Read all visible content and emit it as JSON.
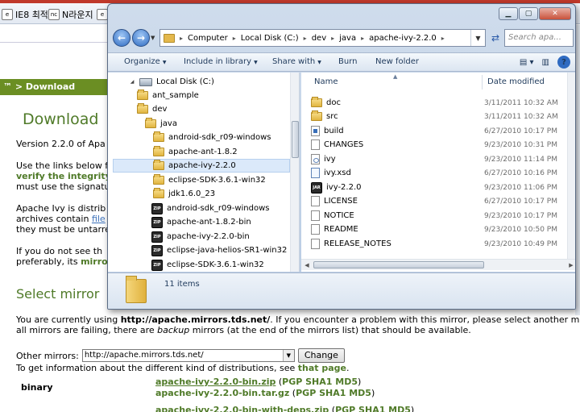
{
  "browser": {
    "favorites": [
      "IE8 최적화",
      "N라운지"
    ],
    "breadcrumb": "™ > Download",
    "page_title": "Download",
    "para1": "Version 2.2.0 of Apa",
    "para2": [
      "Use the links below f",
      "verify the integrity",
      "must use the signatu"
    ],
    "para3": [
      "Apache Ivy is distrib",
      "archives contain",
      "file",
      "they must be untarre"
    ],
    "para4": [
      "If you do not see th",
      "preferably, its",
      "mirror"
    ],
    "select_mirror_heading": "Select mirror",
    "using_line": {
      "pre": "You are currently using ",
      "url": "http://apache.mirrors.tds.net/",
      "post": ". If you encounter a problem with this mirror, please select another m"
    },
    "backup_line": {
      "pre": "all mirrors are failing, there are ",
      "em": "backup",
      "post": " mirrors (at the end of the mirrors list) that should be available."
    },
    "other_mirrors_label": "Other mirrors:",
    "mirror_value": "http://apache.mirrors.tds.net/",
    "change_button": "Change",
    "info_line": {
      "pre": "To get information about the different kind of distributions, see ",
      "link": "that page",
      "post": "."
    },
    "binary_label": "binary",
    "downloads": [
      {
        "file": "apache-ivy-2.2.0-bin.zip",
        "sigs": "PGP SHA1 MD5"
      },
      {
        "file": "apache-ivy-2.2.0-bin.tar.gz",
        "sigs": "PGP SHA1 MD5"
      },
      {
        "file": "apache-ivy-2.2.0-bin-with-deps.zip",
        "sigs": "PGP SHA1 MD5"
      }
    ]
  },
  "explorer": {
    "address": [
      "Computer",
      "Local Disk (C:)",
      "dev",
      "java",
      "apache-ivy-2.2.0"
    ],
    "search_placeholder": "Search apa...",
    "toolbar": {
      "organize": "Organize",
      "include_in_library": "Include in library",
      "share_with": "Share with",
      "burn": "Burn",
      "new_folder": "New folder"
    },
    "tree": [
      {
        "label": "Local Disk (C:)",
        "icon": "drive-icon"
      },
      {
        "label": "ant_sample",
        "icon": "folder-icon"
      },
      {
        "label": "dev",
        "icon": "folder-icon"
      },
      {
        "label": "java",
        "icon": "folder-icon"
      },
      {
        "label": "android-sdk_r09-windows",
        "icon": "folder-icon"
      },
      {
        "label": "apache-ant-1.8.2",
        "icon": "folder-icon"
      },
      {
        "label": "apache-ivy-2.2.0",
        "icon": "folder-icon",
        "selected": true
      },
      {
        "label": "eclipse-SDK-3.6.1-win32",
        "icon": "folder-icon"
      },
      {
        "label": "jdk1.6.0_23",
        "icon": "folder-icon"
      },
      {
        "label": "android-sdk_r09-windows",
        "icon": "zip-icon"
      },
      {
        "label": "apache-ant-1.8.2-bin",
        "icon": "zip-icon"
      },
      {
        "label": "apache-ivy-2.2.0-bin",
        "icon": "zip-icon"
      },
      {
        "label": "eclipse-java-helios-SR1-win32",
        "icon": "zip-icon"
      },
      {
        "label": "eclipse-SDK-3.6.1-win32",
        "icon": "zip-icon"
      }
    ],
    "columns": {
      "name": "Name",
      "date_modified": "Date modified"
    },
    "files": [
      {
        "name": "doc",
        "date": "3/11/2011 10:32 AM",
        "icon": "folder-icon"
      },
      {
        "name": "src",
        "date": "3/11/2011 10:32 AM",
        "icon": "folder-icon"
      },
      {
        "name": "build",
        "date": "6/27/2010 10:17 PM",
        "icon": "build-file-icon"
      },
      {
        "name": "CHANGES",
        "date": "9/23/2010 10:31 PM",
        "icon": "document-icon"
      },
      {
        "name": "ivy",
        "date": "9/23/2010 11:14 PM",
        "icon": "ivy-file-icon"
      },
      {
        "name": "ivy.xsd",
        "date": "6/27/2010 10:16 PM",
        "icon": "xml-file-icon"
      },
      {
        "name": "ivy-2.2.0",
        "date": "9/23/2010 11:06 PM",
        "icon": "jar-icon"
      },
      {
        "name": "LICENSE",
        "date": "6/27/2010 10:17 PM",
        "icon": "document-icon"
      },
      {
        "name": "NOTICE",
        "date": "9/23/2010 10:17 PM",
        "icon": "document-icon"
      },
      {
        "name": "README",
        "date": "9/23/2010 10:50 PM",
        "icon": "document-icon"
      },
      {
        "name": "RELEASE_NOTES",
        "date": "9/23/2010 10:49 PM",
        "icon": "document-icon"
      }
    ],
    "item_count": "11 items"
  }
}
